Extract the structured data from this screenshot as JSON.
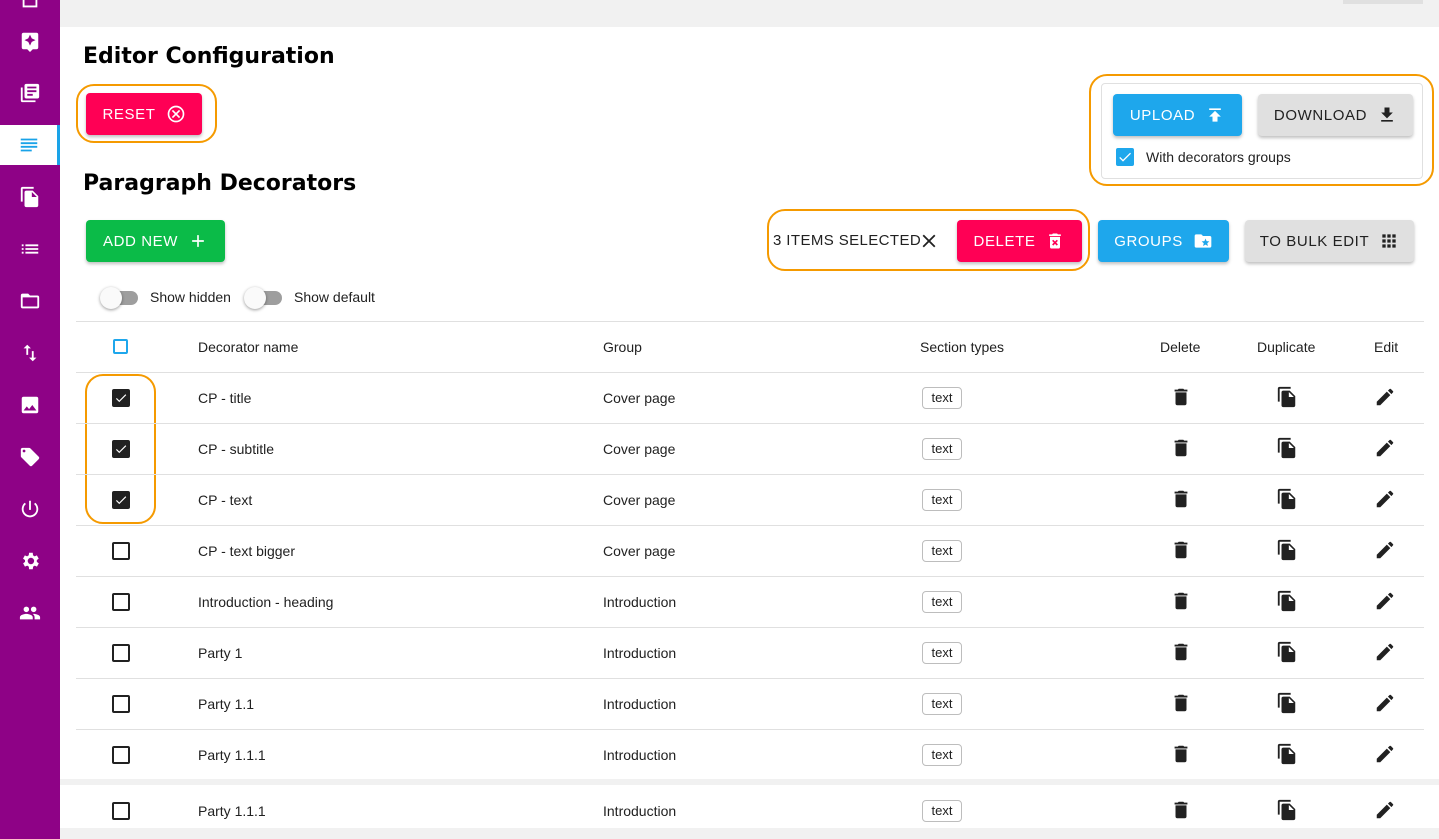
{
  "sidebar": {
    "items": [
      {
        "icon": "window-icon"
      },
      {
        "icon": "sparkle-icon"
      },
      {
        "icon": "library-icon"
      },
      {
        "icon": "paragraph-icon",
        "active": true
      },
      {
        "icon": "copy-icon"
      },
      {
        "icon": "list-icon"
      },
      {
        "icon": "folder-icon"
      },
      {
        "icon": "sort-icon"
      },
      {
        "icon": "image-icon"
      },
      {
        "icon": "tag-icon"
      },
      {
        "icon": "power-icon"
      },
      {
        "icon": "gear-icon"
      },
      {
        "icon": "users-icon"
      }
    ]
  },
  "editor": {
    "title": "Editor Configuration",
    "reset_label": "RESET",
    "upload_label": "UPLOAD",
    "download_label": "DOWNLOAD",
    "with_groups_label": "With decorators groups",
    "with_groups_checked": true
  },
  "decorators": {
    "title": "Paragraph Decorators",
    "add_new_label": "ADD NEW",
    "selected_label": "3 ITEMS SELECTED",
    "delete_label": "DELETE",
    "groups_label": "GROUPS",
    "bulk_edit_label": "TO BULK EDIT",
    "show_hidden_label": "Show hidden",
    "show_default_label": "Show default"
  },
  "table": {
    "columns": {
      "name": "Decorator name",
      "group": "Group",
      "section_types": "Section types",
      "delete": "Delete",
      "duplicate": "Duplicate",
      "edit": "Edit"
    },
    "rows": [
      {
        "name": "CP - title",
        "group": "Cover page",
        "type": "text",
        "checked": true
      },
      {
        "name": "CP - subtitle",
        "group": "Cover page",
        "type": "text",
        "checked": true
      },
      {
        "name": "CP - text",
        "group": "Cover page",
        "type": "text",
        "checked": true
      },
      {
        "name": "CP - text bigger",
        "group": "Cover page",
        "type": "text",
        "checked": false
      },
      {
        "name": "Introduction - heading",
        "group": "Introduction",
        "type": "text",
        "checked": false
      },
      {
        "name": "Party 1",
        "group": "Introduction",
        "type": "text",
        "checked": false
      },
      {
        "name": "Party 1.1",
        "group": "Introduction",
        "type": "text",
        "checked": false
      },
      {
        "name": "Party 1.1.1",
        "group": "Introduction",
        "type": "text",
        "checked": false
      },
      {
        "name": "Party 1.1.1",
        "group": "Introduction",
        "type": "text",
        "checked": false
      }
    ]
  },
  "colors": {
    "sidebar": "#8e0286",
    "accent_red": "#ff0055",
    "accent_blue": "#1ea7ec",
    "accent_green": "#0bbb48",
    "highlight_orange": "#f59a00"
  }
}
